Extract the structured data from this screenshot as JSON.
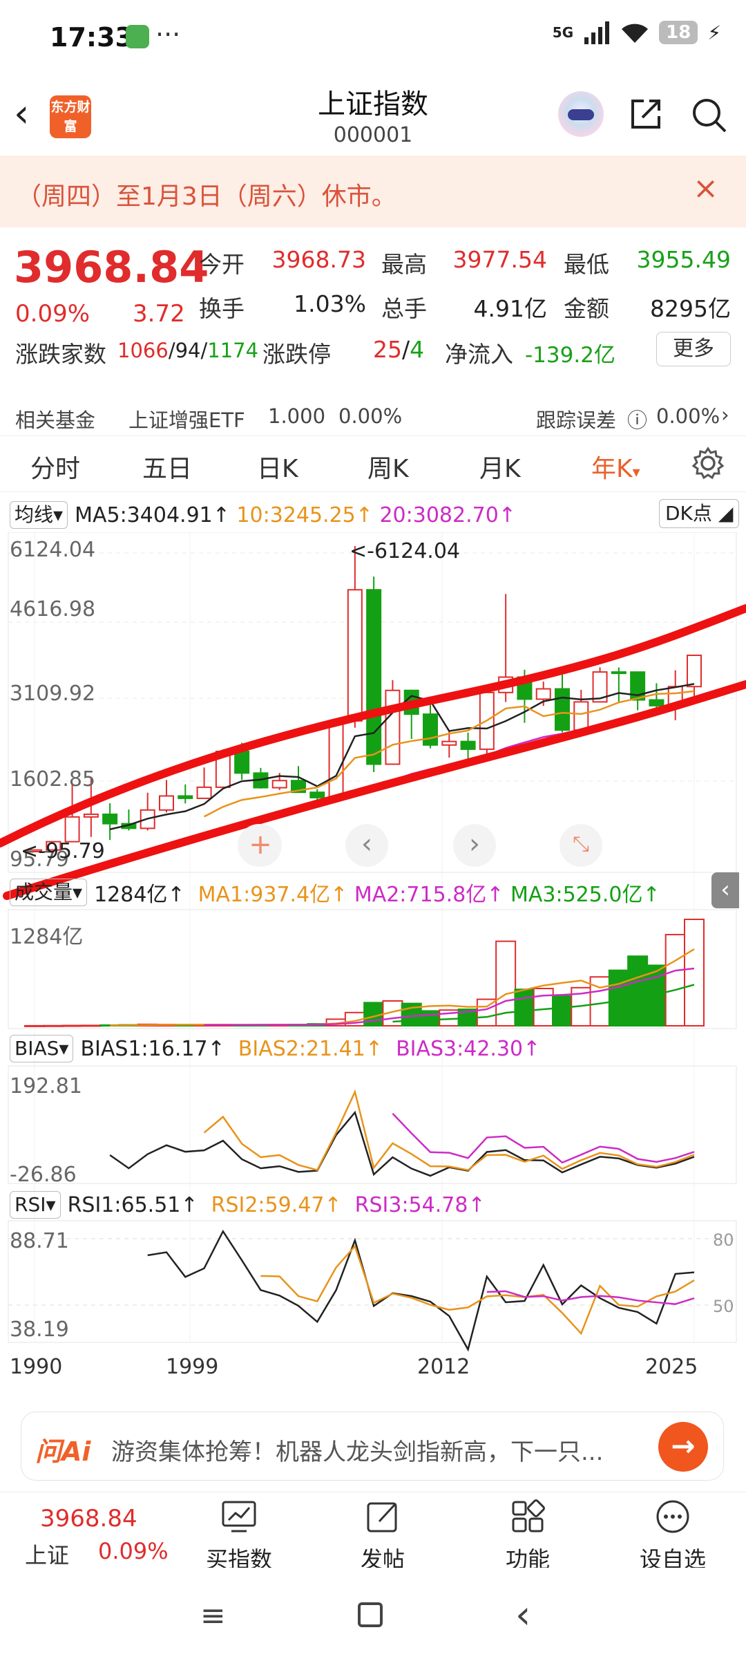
{
  "status": {
    "time": "17:33",
    "dots": "···",
    "network": "5G",
    "battery": "18"
  },
  "header": {
    "logo": "东方财富",
    "title": "上证指数",
    "code": "000001"
  },
  "notice": {
    "text": "（周四）至1月3日（周六）休市。",
    "close": "×"
  },
  "quote": {
    "price": "3968.84",
    "pct": "0.09%",
    "change": "3.72",
    "open_label": "今开",
    "open": "3968.73",
    "high_label": "最高",
    "high": "3977.54",
    "low_label": "最低",
    "low": "3955.49",
    "turnover_label": "换手",
    "turnover": "1.03%",
    "volume_label": "总手",
    "volume": "4.91亿",
    "amount_label": "金额",
    "amount": "8295亿",
    "breadth_label": "涨跌家数",
    "breadth_up": "1066",
    "breadth_flat": "94",
    "breadth_down": "1174",
    "limit_label": "涨跌停",
    "limit_up": "25",
    "limit_down": "4",
    "inflow_label": "净流入",
    "inflow": "-139.2亿",
    "more": "更多"
  },
  "fund": {
    "label": "相关基金",
    "name": "上证增强ETF",
    "price": "1.000",
    "pct": "0.00%",
    "track_label": "跟踪误差",
    "track": "0.00%"
  },
  "tabs": [
    "分时",
    "五日",
    "日K",
    "周K",
    "月K",
    "年K"
  ],
  "active_tab": "年K",
  "ma_bar": {
    "selector": "均线",
    "ma5": "MA5:3404.91↑",
    "ma10": "10:3245.25↑",
    "ma20": "20:3082.70↑",
    "dk": "DK点"
  },
  "vol_bar": {
    "selector": "成交量",
    "vol": "1284亿↑",
    "ma1": "MA1:937.4亿↑",
    "ma2": "MA2:715.8亿↑",
    "ma3": "MA3:525.0亿↑"
  },
  "bias_bar": {
    "selector": "BIAS",
    "b1": "BIAS1:16.17↑",
    "b2": "BIAS2:21.41↑",
    "b3": "BIAS3:42.30↑"
  },
  "rsi_bar": {
    "selector": "RSI",
    "r1": "RSI1:65.51↑",
    "r2": "RSI2:59.47↑",
    "r3": "RSI3:54.78↑"
  },
  "chart_data": {
    "type": "candlestick",
    "y_ticks": [
      "6124.04",
      "4616.98",
      "3109.92",
      "1602.85",
      "95.79"
    ],
    "max_label": "<-6124.04",
    "min_label": "<-95.79",
    "vol_tick": "1284亿",
    "bias_ticks": [
      "192.81",
      "-26.86"
    ],
    "rsi_ticks": [
      "88.71",
      "38.19"
    ],
    "rsi_ref": [
      "80",
      "50"
    ],
    "x_ticks": [
      "1990",
      "1999",
      "2012",
      "2025"
    ],
    "candles": [
      {
        "o": 96,
        "c": 128,
        "h": 128,
        "l": 96
      },
      {
        "o": 128,
        "c": 292,
        "h": 292,
        "l": 105
      },
      {
        "o": 292,
        "c": 780,
        "h": 1429,
        "l": 292
      },
      {
        "o": 780,
        "c": 833,
        "h": 1558,
        "l": 386
      },
      {
        "o": 833,
        "c": 647,
        "h": 1052,
        "l": 325
      },
      {
        "o": 647,
        "c": 555,
        "h": 927,
        "l": 512
      },
      {
        "o": 555,
        "c": 917,
        "h": 1258,
        "l": 513
      },
      {
        "o": 917,
        "c": 1194,
        "h": 1510,
        "l": 870
      },
      {
        "o": 1194,
        "c": 1147,
        "h": 1422,
        "l": 1047
      },
      {
        "o": 1147,
        "c": 1366,
        "h": 1756,
        "l": 1341
      },
      {
        "o": 1366,
        "c": 2073,
        "h": 2114,
        "l": 1361
      },
      {
        "o": 2073,
        "c": 1646,
        "h": 2245,
        "l": 1514
      },
      {
        "o": 1646,
        "c": 1357,
        "h": 1748,
        "l": 1339
      },
      {
        "o": 1357,
        "c": 1497,
        "h": 1649,
        "l": 1311
      },
      {
        "o": 1497,
        "c": 1266,
        "h": 1783,
        "l": 1259
      },
      {
        "o": 1266,
        "c": 1161,
        "h": 1328,
        "l": 998
      },
      {
        "o": 1161,
        "c": 2675,
        "h": 2698,
        "l": 1161
      },
      {
        "o": 2675,
        "c": 5262,
        "h": 6124,
        "l": 2541
      },
      {
        "o": 5262,
        "c": 1821,
        "h": 5522,
        "l": 1664
      },
      {
        "o": 1821,
        "c": 3277,
        "h": 3478,
        "l": 1844
      },
      {
        "o": 3277,
        "c": 2808,
        "h": 3186,
        "l": 2319
      },
      {
        "o": 2808,
        "c": 2199,
        "h": 3067,
        "l": 2134
      },
      {
        "o": 2199,
        "c": 2269,
        "h": 2478,
        "l": 1949
      },
      {
        "o": 2269,
        "c": 2116,
        "h": 2444,
        "l": 1849
      },
      {
        "o": 2116,
        "c": 3235,
        "h": 3239,
        "l": 1974
      },
      {
        "o": 3235,
        "c": 3539,
        "h": 5178,
        "l": 3049
      },
      {
        "o": 3539,
        "c": 3104,
        "h": 3684,
        "l": 2638
      },
      {
        "o": 3104,
        "c": 3307,
        "h": 3451,
        "l": 2969
      },
      {
        "o": 3307,
        "c": 2494,
        "h": 3587,
        "l": 2449
      },
      {
        "o": 2494,
        "c": 3050,
        "h": 3288,
        "l": 2440
      },
      {
        "o": 3050,
        "c": 3640,
        "h": 3732,
        "l": 3050
      },
      {
        "o": 3640,
        "c": 3639,
        "h": 3731,
        "l": 3023
      },
      {
        "o": 3639,
        "c": 3089,
        "h": 3424,
        "l": 2885
      },
      {
        "o": 3089,
        "c": 2975,
        "h": 3418,
        "l": 2923
      },
      {
        "o": 2975,
        "c": 3352,
        "h": 3674,
        "l": 2689
      },
      {
        "o": 3352,
        "c": 3969,
        "h": 3977,
        "l": 3040
      }
    ],
    "volumes": [
      1,
      2,
      4,
      5,
      9,
      12,
      18,
      16,
      14,
      12,
      13,
      10,
      11,
      14,
      16,
      24,
      80,
      160,
      280,
      300,
      270,
      180,
      190,
      200,
      320,
      1020,
      440,
      450,
      360,
      460,
      590,
      670,
      840,
      730,
      1100,
      1284
    ]
  }
}
